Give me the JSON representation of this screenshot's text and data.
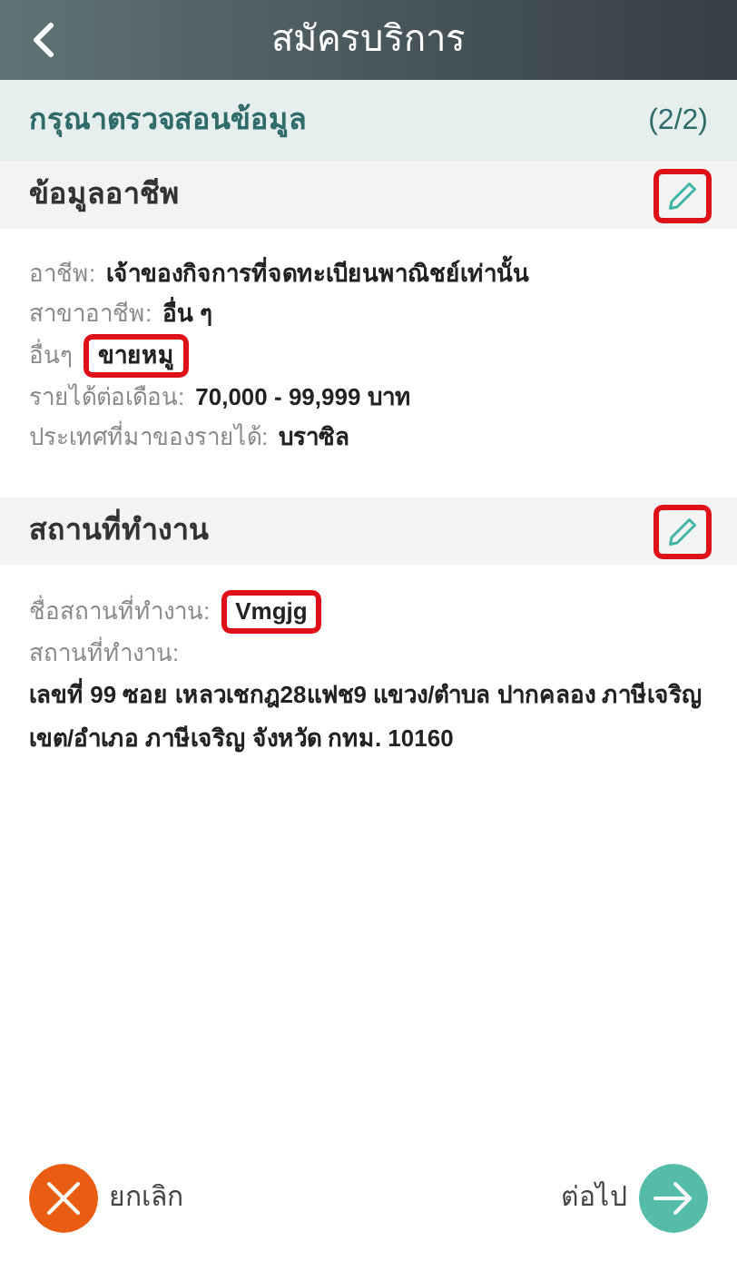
{
  "header": {
    "title": "สมัครบริการ"
  },
  "review_bar": {
    "title": "กรุณาตรวจสอนข้อมูล",
    "step": "(2/2)"
  },
  "sections": [
    {
      "title": "ข้อมูลอาชีพ",
      "edit_highlighted": true,
      "fields": [
        {
          "kind": "inline",
          "label": "อาชีพ:",
          "value": "เจ้าของกิจการที่จดทะเบียนพาณิชย์เท่านั้น",
          "highlighted": false
        },
        {
          "kind": "inline",
          "label": "สาขาอาชีพ:",
          "value": "อื่น ๆ",
          "highlighted": false
        },
        {
          "kind": "inline",
          "label": "อื่นๆ",
          "value": "ขายหมู",
          "highlighted": true
        },
        {
          "kind": "inline",
          "label": "รายได้ต่อเดือน:",
          "value": "70,000 - 99,999 บาท",
          "highlighted": false
        },
        {
          "kind": "inline",
          "label": "ประเทศที่มาของรายได้:",
          "value": "บราซิล",
          "highlighted": false
        }
      ]
    },
    {
      "title": "สถานที่ทำงาน",
      "edit_highlighted": true,
      "fields": [
        {
          "kind": "inline",
          "label": "ชื่อสถานที่ทำงาน:",
          "value": "Vmgjg",
          "highlighted": true
        },
        {
          "kind": "stacked",
          "label": "สถานที่ทำงาน:",
          "value": "เลขที่ 99 ซอย เหลวเชกฎ28แฟช9 แขวง/ตำบล ปากคลอง ภาษีเจริญ เขต/อำเภอ ภาษีเจริญ จังหวัด กทม. 10160",
          "highlighted": false
        }
      ]
    }
  ],
  "footer": {
    "cancel": "ยกเลิก",
    "next": "ต่อไป"
  }
}
